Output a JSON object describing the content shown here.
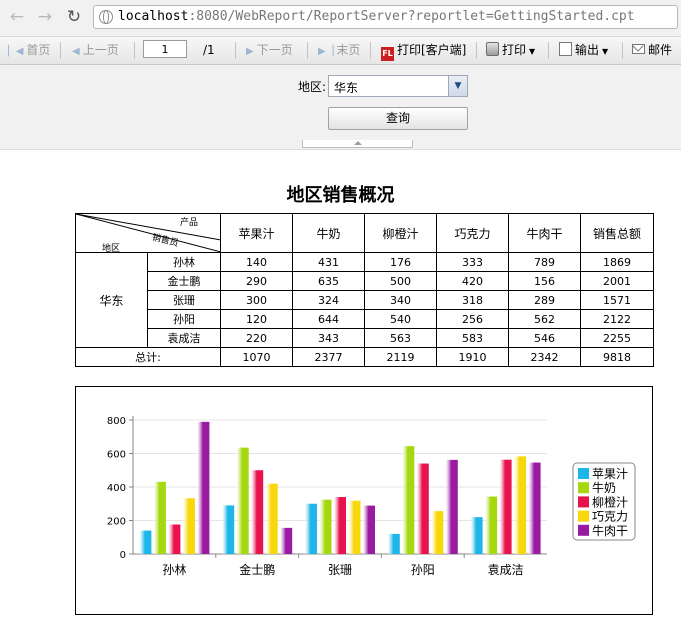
{
  "browser": {
    "url_host": "localhost",
    "url_rest": ":8080/WebReport/ReportServer?reportlet=GettingStarted.cpt",
    "back_icon": "arrow-left-icon",
    "forward_icon": "arrow-right-icon",
    "reload_icon": "reload-icon"
  },
  "toolbar": {
    "first": "首页",
    "prev": "上一页",
    "page_value": "1",
    "page_total": "/1",
    "next": "下一页",
    "last": "末页",
    "print_client": "打印[客户端]",
    "print": "打印",
    "export": "输出",
    "mail": "邮件"
  },
  "params": {
    "region_label": "地区:",
    "region_value": "华东",
    "query_button": "查询"
  },
  "report": {
    "title": "地区销售概况",
    "header_corner": {
      "product": "产品",
      "salesperson": "销售员",
      "region": "地区"
    },
    "products": [
      "苹果汁",
      "牛奶",
      "柳橙汁",
      "巧克力",
      "牛肉干"
    ],
    "total_header": "销售总额",
    "region": "华东",
    "rows": [
      {
        "name": "孙林",
        "values": [
          "140",
          "431",
          "176",
          "333",
          "789"
        ],
        "total": "1869"
      },
      {
        "name": "金士鹏",
        "values": [
          "290",
          "635",
          "500",
          "420",
          "156"
        ],
        "total": "2001"
      },
      {
        "name": "张珊",
        "values": [
          "300",
          "324",
          "340",
          "318",
          "289"
        ],
        "total": "1571"
      },
      {
        "name": "孙阳",
        "values": [
          "120",
          "644",
          "540",
          "256",
          "562"
        ],
        "total": "2122"
      },
      {
        "name": "袁成洁",
        "values": [
          "220",
          "343",
          "563",
          "583",
          "546"
        ],
        "total": "2255"
      }
    ],
    "sum_label": "总计:",
    "sum_values": [
      "1070",
      "2377",
      "2119",
      "1910",
      "2342"
    ],
    "sum_total": "9818"
  },
  "chart_data": {
    "type": "bar",
    "categories": [
      "孙林",
      "金士鹏",
      "张珊",
      "孙阳",
      "袁成洁"
    ],
    "series": [
      {
        "name": "苹果汁",
        "color": "#1eb6e8",
        "values": [
          140,
          290,
          300,
          120,
          220
        ]
      },
      {
        "name": "牛奶",
        "color": "#a5d80e",
        "values": [
          431,
          635,
          324,
          644,
          343
        ]
      },
      {
        "name": "柳橙汁",
        "color": "#e8134c",
        "values": [
          176,
          500,
          340,
          540,
          563
        ]
      },
      {
        "name": "巧克力",
        "color": "#f7d80a",
        "values": [
          333,
          420,
          318,
          256,
          583
        ]
      },
      {
        "name": "牛肉干",
        "color": "#9a1aa1",
        "values": [
          789,
          156,
          289,
          562,
          546
        ]
      }
    ],
    "ylim": [
      0,
      800
    ],
    "yticks": [
      0,
      200,
      400,
      600,
      800
    ],
    "grid": true,
    "legend": "right"
  }
}
